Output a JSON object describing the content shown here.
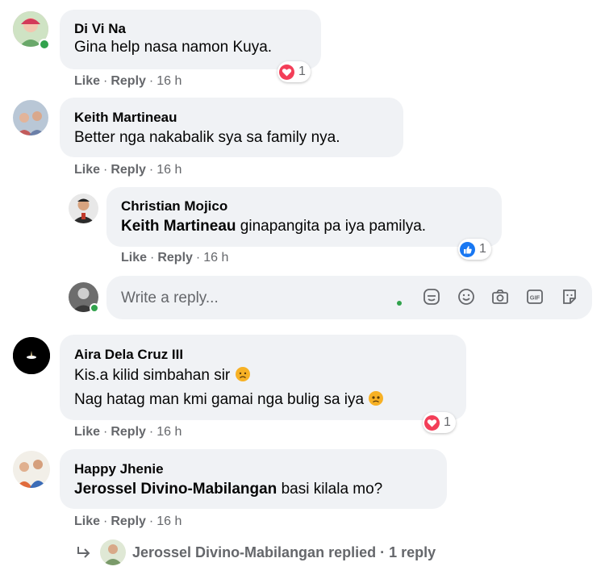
{
  "comments": [
    {
      "name": "Di Vi Na",
      "text": "Gina help nasa namon Kuya.",
      "like": "Like",
      "reply": "Reply",
      "time": "16 h",
      "reaction": "love",
      "reaction_count": "1"
    },
    {
      "name": "Keith Martineau",
      "text": "Better nga nakabalik sya sa family nya.",
      "like": "Like",
      "reply": "Reply",
      "time": "16 h"
    },
    {
      "name": "Christian Mojico",
      "mention": "Keith Martineau",
      "text": " ginapangita pa iya pamilya.",
      "like": "Like",
      "reply": "Reply",
      "time": "16 h",
      "reaction": "like",
      "reaction_count": "1"
    },
    {
      "name": "Aira Dela Cruz III",
      "line1": "Kis.a kilid simbahan sir",
      "line2": "Nag hatag man kmi gamai nga bulig sa iya",
      "like": "Like",
      "reply": "Reply",
      "time": "16 h",
      "reaction": "love",
      "reaction_count": "1"
    },
    {
      "name": "Happy Jhenie",
      "mention": "Jerossel Divino-Mabilangan",
      "text": " basi kilala mo?",
      "like": "Like",
      "reply": "Reply",
      "time": "16 h"
    }
  ],
  "reply_box": {
    "placeholder": "Write a reply..."
  },
  "replies_link": {
    "author": "Jerossel Divino-Mabilangan",
    "text": "replied",
    "count": "1 reply"
  },
  "separator": "·",
  "colors": {
    "bubble": "#f0f2f5",
    "meta": "#65676b",
    "like_blue": "#1877f2",
    "love_red": "#f33e58",
    "online": "#31a24c",
    "emoji_yellow": "#f7b125"
  },
  "icons": [
    "emoji-sticker-icon",
    "smiley-icon",
    "camera-icon",
    "gif-icon",
    "sticker-icon",
    "love-reaction-icon",
    "like-reaction-icon",
    "sad-emoji-icon",
    "reply-arrow-icon"
  ]
}
